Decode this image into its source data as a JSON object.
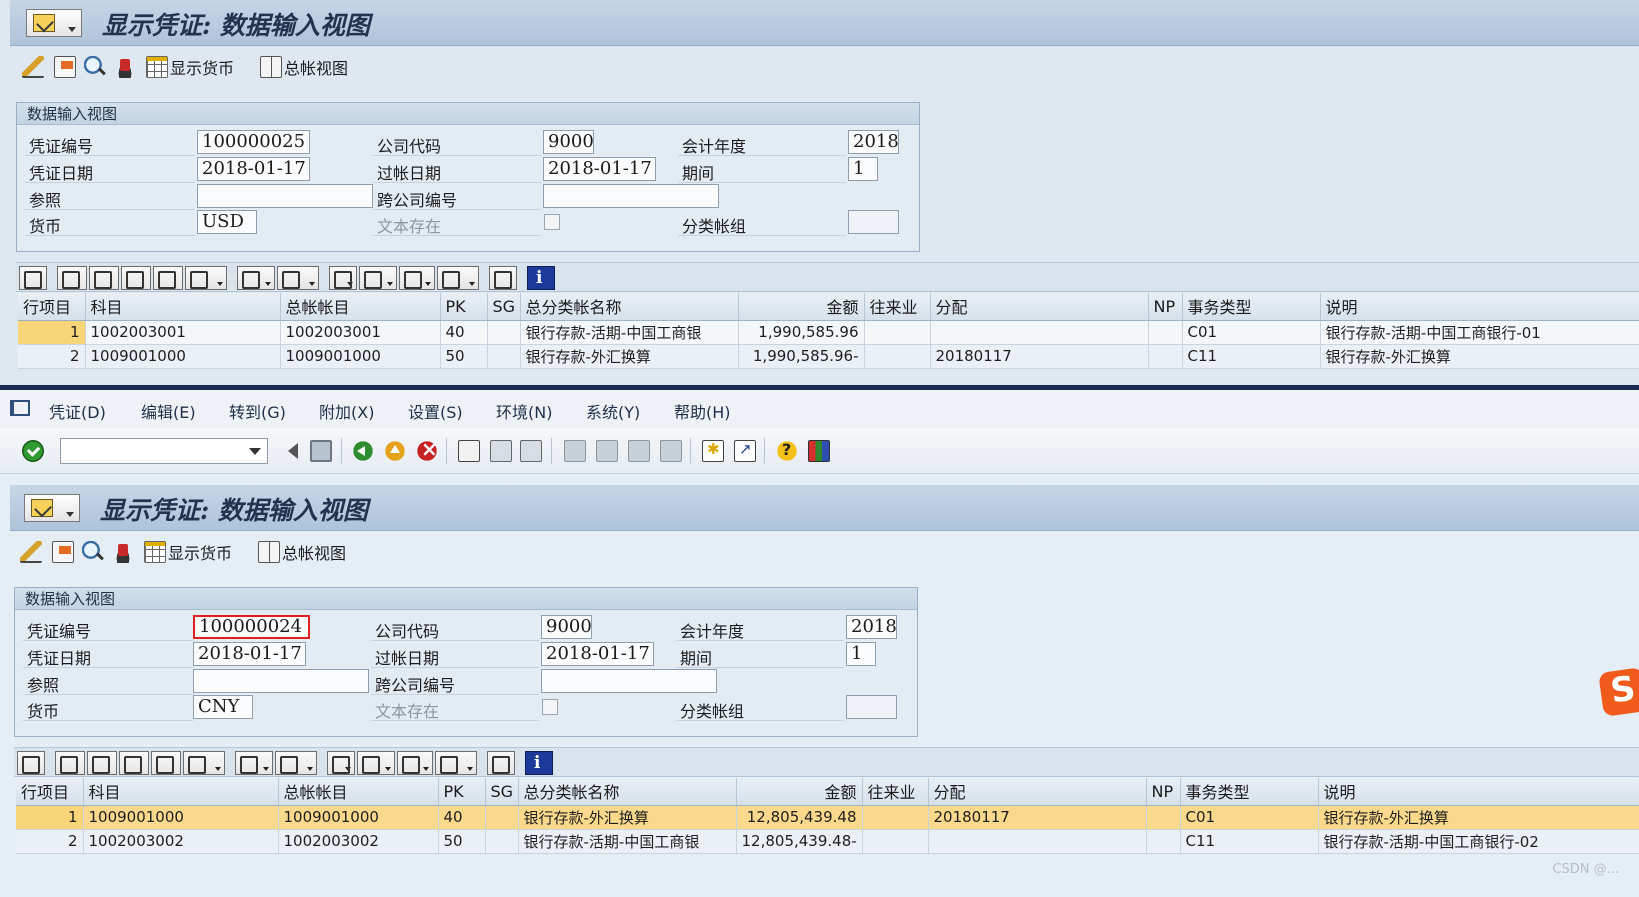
{
  "top": {
    "title": "显示凭证: 数据输入视图",
    "toolbar": {
      "show_currency": "显示货币",
      "gl_view": "总帐视图"
    },
    "header": {
      "frame_title": "数据输入视图",
      "doc_number_label": "凭证编号",
      "doc_number": "100000025",
      "company_code_label": "公司代码",
      "company_code": "9000",
      "fiscal_year_label": "会计年度",
      "fiscal_year": "2018",
      "doc_date_label": "凭证日期",
      "doc_date": "2018-01-17",
      "posting_date_label": "过帐日期",
      "posting_date": "2018-01-17",
      "period_label": "期间",
      "period": "1",
      "reference_label": "参照",
      "reference": "",
      "cross_company_label": "跨公司编号",
      "cross_company": "",
      "currency_label": "货币",
      "currency": "USD",
      "text_exists_label": "文本存在",
      "ledger_group_label": "分类帐组",
      "ledger_group": ""
    },
    "columns": [
      "行项目",
      "科目",
      "总帐帐目",
      "PK",
      "SG",
      "总分类帐名称",
      "金额",
      "往来业",
      "分配",
      "NP",
      "事务类型",
      "说明"
    ],
    "rows": [
      [
        "1",
        "1002003001",
        "1002003001",
        "40",
        "",
        "银行存款-活期-中国工商银",
        "1,990,585.96",
        "",
        "",
        "",
        "C01",
        "银行存款-活期-中国工商银行-01"
      ],
      [
        "2",
        "1009001000",
        "1009001000",
        "50",
        "",
        "银行存款-外汇换算",
        "1,990,585.96-",
        "",
        "20180117",
        "",
        "C11",
        "银行存款-外汇换算"
      ]
    ]
  },
  "menu": [
    "凭证(D)",
    "编辑(E)",
    "转到(G)",
    "附加(X)",
    "设置(S)",
    "环境(N)",
    "系统(Y)",
    "帮助(H)"
  ],
  "command_field": "",
  "bottom": {
    "title": "显示凭证: 数据输入视图",
    "toolbar": {
      "show_currency": "显示货币",
      "gl_view": "总帐视图"
    },
    "header": {
      "frame_title": "数据输入视图",
      "doc_number_label": "凭证编号",
      "doc_number": "100000024",
      "company_code_label": "公司代码",
      "company_code": "9000",
      "fiscal_year_label": "会计年度",
      "fiscal_year": "2018",
      "doc_date_label": "凭证日期",
      "doc_date": "2018-01-17",
      "posting_date_label": "过帐日期",
      "posting_date": "2018-01-17",
      "period_label": "期间",
      "period": "1",
      "reference_label": "参照",
      "reference": "",
      "cross_company_label": "跨公司编号",
      "cross_company": "",
      "currency_label": "货币",
      "currency": "CNY",
      "text_exists_label": "文本存在",
      "ledger_group_label": "分类帐组",
      "ledger_group": ""
    },
    "columns": [
      "行项目",
      "科目",
      "总帐帐目",
      "PK",
      "SG",
      "总分类帐名称",
      "金额",
      "往来业",
      "分配",
      "NP",
      "事务类型",
      "说明"
    ],
    "rows": [
      [
        "1",
        "1009001000",
        "1009001000",
        "40",
        "",
        "银行存款-外汇换算",
        "12,805,439.48",
        "",
        "20180117",
        "",
        "C01",
        "银行存款-外汇换算"
      ],
      [
        "2",
        "1002003002",
        "1002003002",
        "50",
        "",
        "银行存款-活期-中国工商银",
        "12,805,439.48-",
        "",
        "",
        "",
        "C11",
        "银行存款-活期-中国工商银行-02"
      ]
    ]
  },
  "watermark": "CSDN @..."
}
